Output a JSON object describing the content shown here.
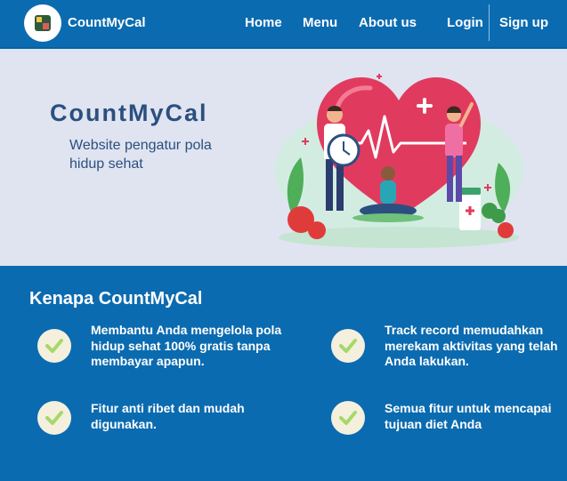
{
  "navbar": {
    "brand": "CountMyCal",
    "links": {
      "home": "Home",
      "menu": "Menu",
      "about": "About us",
      "login": "Login",
      "signup": "Sign up"
    }
  },
  "hero": {
    "title": "CountMyCal",
    "subtitle": "Website pengatur pola hidup sehat"
  },
  "features": {
    "title": "Kenapa CountMyCal",
    "items": [
      {
        "text": "Membantu Anda mengelola pola hidup sehat 100% gratis tanpa membayar apapun.",
        "icon": "check-icon"
      },
      {
        "text": "Track record memudahkan merekam aktivitas yang telah Anda lakukan.",
        "icon": "check-icon"
      },
      {
        "text": "Fitur anti ribet dan mudah digunakan.",
        "icon": "check-icon"
      },
      {
        "text": "Semua fitur untuk mencapai tujuan diet Anda",
        "icon": "check-icon"
      }
    ]
  },
  "colors": {
    "primary": "#0b6bb0",
    "hero_bg": "#dfe4f0",
    "hero_text": "#2b4f7f",
    "check_bg": "#f4f0dd",
    "check_mark": "#a6d86a"
  }
}
